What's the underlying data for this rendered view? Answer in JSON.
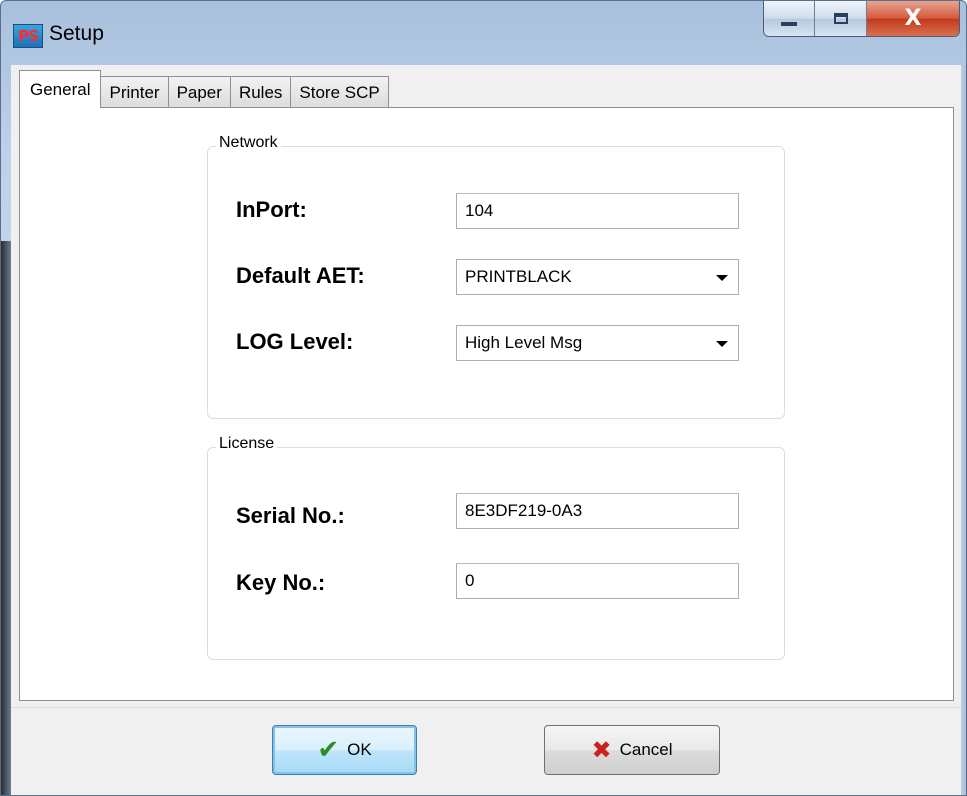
{
  "window": {
    "app_icon_text": "PS",
    "title": "Setup",
    "close_glyph": "X"
  },
  "tabs": [
    {
      "label": "General",
      "active": true
    },
    {
      "label": "Printer",
      "active": false
    },
    {
      "label": "Paper",
      "active": false
    },
    {
      "label": "Rules",
      "active": false
    },
    {
      "label": "Store SCP",
      "active": false
    }
  ],
  "network": {
    "legend": "Network",
    "inport_label": "InPort:",
    "inport_value": "104",
    "aet_label": "Default AET:",
    "aet_value": "PRINTBLACK",
    "log_label": "LOG Level:",
    "log_value": "High Level Msg"
  },
  "license": {
    "legend": "License",
    "serial_label": "Serial No.:",
    "serial_value": "8E3DF219-0A3",
    "key_label": "Key No.:",
    "key_value": "0"
  },
  "buttons": {
    "ok_label": "OK",
    "cancel_label": "Cancel"
  },
  "colors": {
    "ok_icon": "#2e8b1f",
    "cancel_icon": "#cc1f1f",
    "close_button": "#c9472a"
  }
}
